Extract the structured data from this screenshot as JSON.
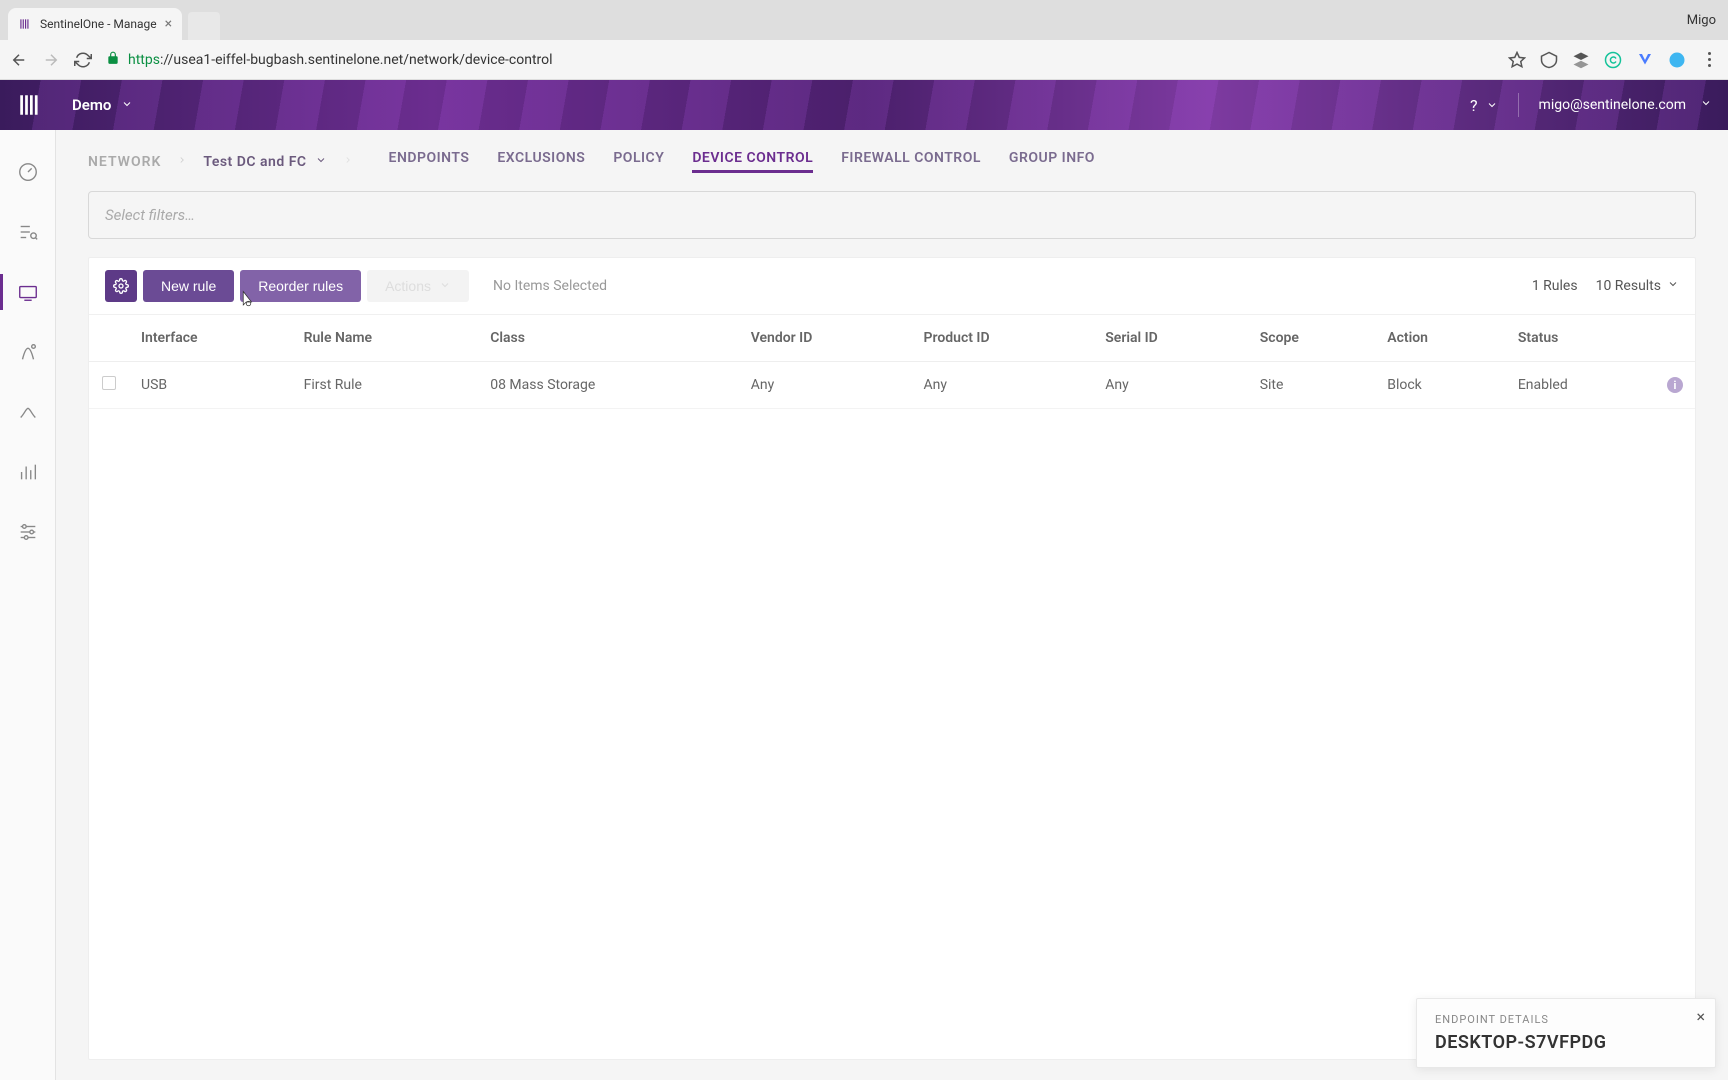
{
  "browser": {
    "tab_title": "SentinelOne - Manage",
    "profile": "Migo",
    "url_scheme": "https",
    "url_host_path": "://usea1-eiffel-bugbash.sentinelone.net/network/device-control"
  },
  "header": {
    "site_name": "Demo",
    "help_label": "?",
    "user_email": "migo@sentinelone.com"
  },
  "breadcrumb": {
    "root": "NETWORK",
    "scope": "Test DC and FC"
  },
  "tabs": [
    {
      "label": "ENDPOINTS",
      "active": false
    },
    {
      "label": "EXCLUSIONS",
      "active": false
    },
    {
      "label": "POLICY",
      "active": false
    },
    {
      "label": "DEVICE CONTROL",
      "active": true
    },
    {
      "label": "FIREWALL CONTROL",
      "active": false
    },
    {
      "label": "GROUP INFO",
      "active": false
    }
  ],
  "filter_placeholder": "Select filters…",
  "toolbar": {
    "new_rule": "New rule",
    "reorder": "Reorder rules",
    "actions": "Actions",
    "no_selection": "No Items Selected",
    "rules_count": "1 Rules",
    "results_label": "10 Results"
  },
  "columns": [
    "Interface",
    "Rule Name",
    "Class",
    "Vendor ID",
    "Product ID",
    "Serial ID",
    "Scope",
    "Action",
    "Status"
  ],
  "rows": [
    {
      "interface": "USB",
      "rule_name": "First Rule",
      "class": "08 Mass Storage",
      "vendor_id": "Any",
      "product_id": "Any",
      "serial_id": "Any",
      "scope": "Site",
      "action": "Block",
      "status": "Enabled"
    }
  ],
  "toast": {
    "label": "ENDPOINT DETAILS",
    "title": "DESKTOP-S7VFPDG"
  }
}
